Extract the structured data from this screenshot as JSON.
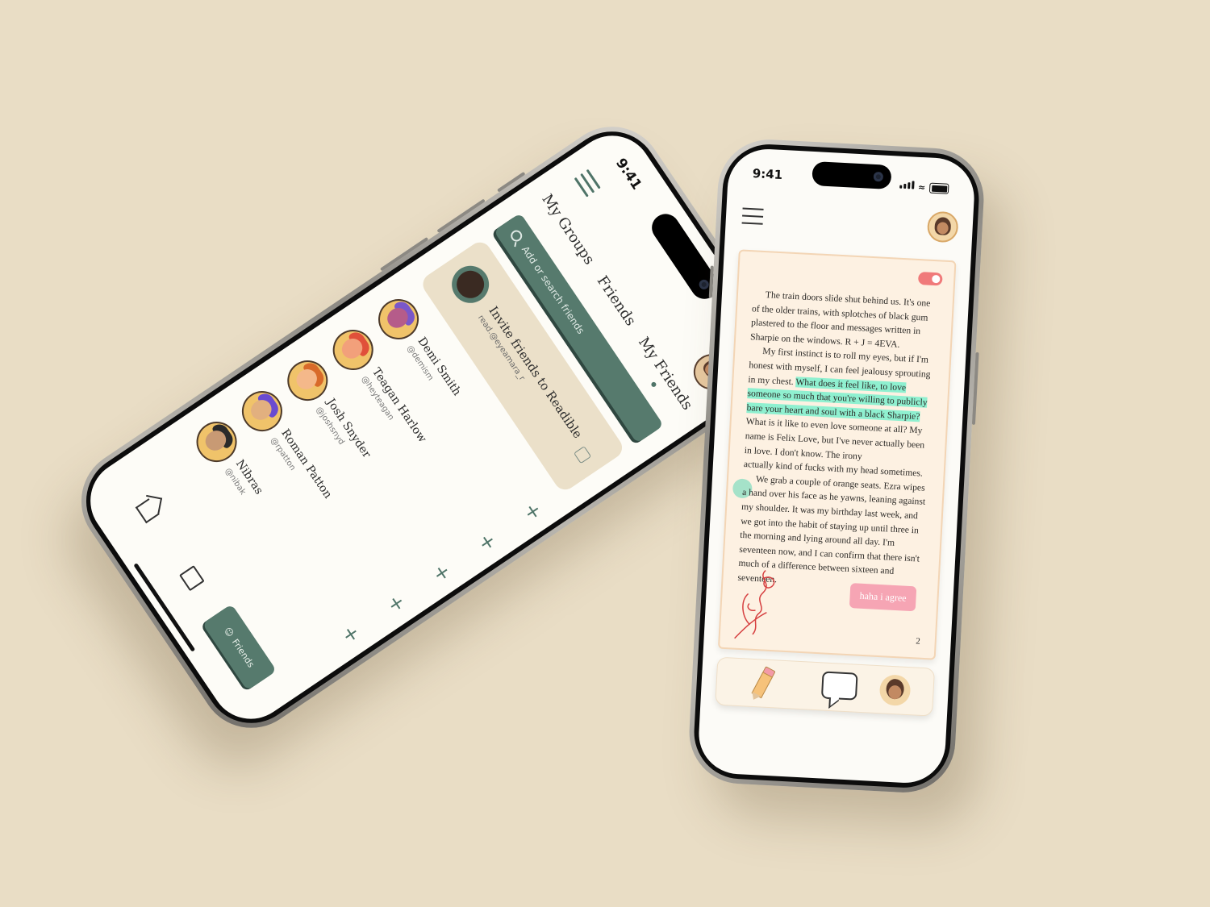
{
  "left_phone": {
    "status": {
      "time": "9:41"
    },
    "tabs": [
      "My Groups",
      "Friends",
      "My Friends"
    ],
    "search": {
      "placeholder": "Add or search friends"
    },
    "invite": {
      "title": "Invite friends to Readible",
      "subtitle": "read.@eyeamara_r"
    },
    "friends": [
      {
        "name": "Demi Smith",
        "handle": "@demism",
        "hair": "#7a57c9",
        "face": "#b55c8a"
      },
      {
        "name": "Teagan Harlow",
        "handle": "@heyteagan",
        "hair": "#e0503a",
        "face": "#f2a07b"
      },
      {
        "name": "Josh Snyder",
        "handle": "@joshsnyd",
        "hair": "#d86a2a",
        "face": "#f4b88a"
      },
      {
        "name": "Roman Patton",
        "handle": "@rpatton",
        "hair": "#6a4bd0",
        "face": "#e2b07f"
      },
      {
        "name": "Nibras",
        "handle": "@nibak",
        "hair": "#2a2a2a",
        "face": "#c89a74"
      }
    ],
    "plus_symbol": "+",
    "nav": {
      "friends_label": "Friends"
    }
  },
  "right_phone": {
    "status": {
      "time": "9:41"
    },
    "book": {
      "p1": "The train doors slide shut behind us. It's one of the older trains, with splotches of black gum plastered to the floor and messages written in Sharpie on the windows. R + J = 4EVA.",
      "p2_before": "My first instinct is to roll my eyes, but if I'm honest with myself, I can feel jealousy sprouting in my chest. ",
      "p2_highlight": "What does it feel like, to love someone so much that you're willing to publicly bare your heart and soul with a black Sharpie?",
      "p2_after": " What is it like to even love someone at all? My name is Felix Love, but I've never actually been in love. I don't know. The irony",
      "p3": "actually kind of fucks with my head sometimes.",
      "p4": "We grab a couple of orange seats. Ezra wipes a hand over his face as he yawns, leaning against my shoulder. It was my birthday last week, and we got into the habit of staying up until three in the morning and lying around all day. I'm seventeen now, and I can confirm that there isn't much of a difference between sixteen and seventeen."
    },
    "note": "haha i agree",
    "page_number": "2"
  },
  "colors": {
    "accent": "#567a6d",
    "background": "#e9ddc5",
    "highlight": "#8ff0d0",
    "note": "#f6a5b4"
  }
}
